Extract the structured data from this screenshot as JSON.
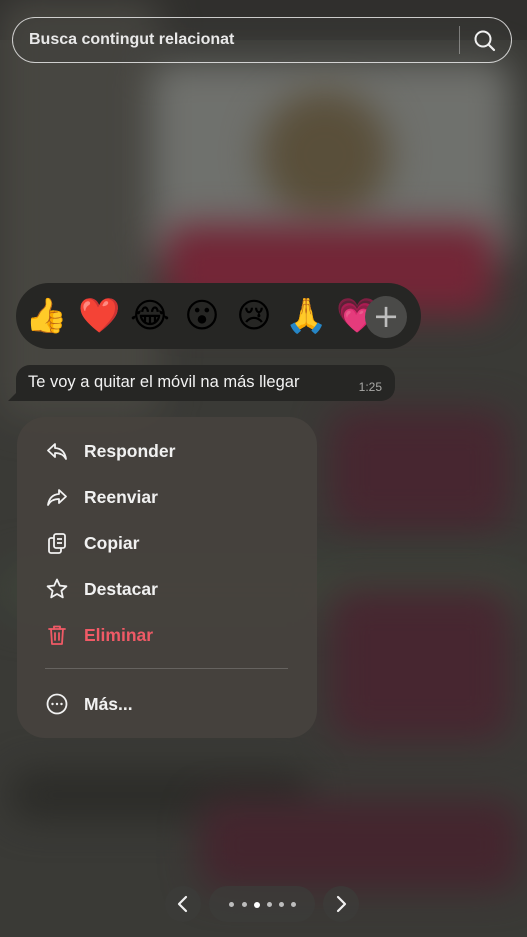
{
  "search": {
    "placeholder": "Busca contingut relacionat",
    "icon": "search-icon"
  },
  "reactions": {
    "emojis": [
      "👍",
      "❤️",
      "😂",
      "😮",
      "😢",
      "🙏",
      "💗"
    ],
    "more_icon": "plus-icon"
  },
  "message": {
    "text": "Te voy a quitar el móvil na más llegar",
    "time": "1:25"
  },
  "menu": {
    "items": [
      {
        "label": "Responder",
        "icon": "reply-icon"
      },
      {
        "label": "Reenviar",
        "icon": "forward-icon"
      },
      {
        "label": "Copiar",
        "icon": "copy-icon"
      },
      {
        "label": "Destacar",
        "icon": "star-icon"
      },
      {
        "label": "Eliminar",
        "icon": "trash-icon",
        "color": "#f05a66"
      },
      {
        "label": "Más...",
        "icon": "more-icon"
      }
    ]
  },
  "pager": {
    "prev_icon": "chevron-left-icon",
    "next_icon": "chevron-right-icon",
    "total_dots": 6,
    "active_dot": 3
  }
}
